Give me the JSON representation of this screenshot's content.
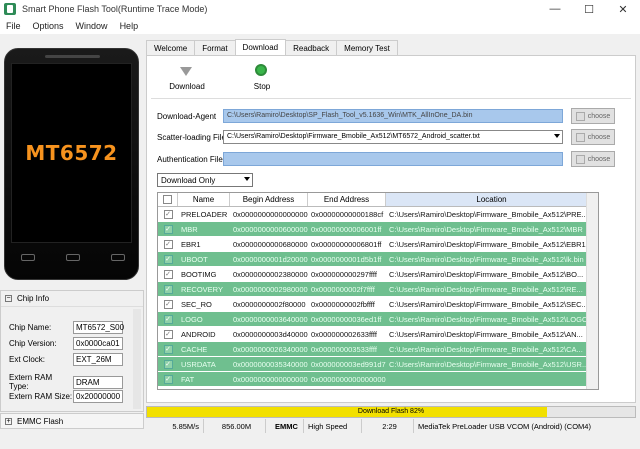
{
  "window": {
    "title": "Smart Phone Flash Tool(Runtime Trace Mode)",
    "minimize": "—",
    "maximize": "☐",
    "close": "✕"
  },
  "menu": [
    "File",
    "Options",
    "Window",
    "Help"
  ],
  "phone": {
    "chip": "MT6572"
  },
  "chip_info": {
    "title": "Chip Info",
    "expand": "−",
    "rows": [
      {
        "label": "Chip Name:",
        "value": "MT6572_S00"
      },
      {
        "label": "Chip Version:",
        "value": "0x0000ca01"
      },
      {
        "label": "Ext Clock:",
        "value": "EXT_26M"
      },
      {
        "label": "Extern RAM Type:",
        "value": "DRAM"
      },
      {
        "label": "Extern RAM Size:",
        "value": "0x20000000"
      }
    ]
  },
  "emmc": {
    "label": "EMMC Flash",
    "expand": "+"
  },
  "tabs": [
    "Welcome",
    "Format",
    "Download",
    "Readback",
    "Memory Test"
  ],
  "toolbar": {
    "download": "Download",
    "stop": "Stop"
  },
  "form": {
    "download_agent_label": "Download-Agent",
    "download_agent_value": "C:\\Users\\Ramiro\\Desktop\\SP_Flash_Tool_v5.1636_Win\\MTK_AllInOne_DA.bin",
    "scatter_label": "Scatter-loading File",
    "scatter_value": "C:\\Users\\Ramiro\\Desktop\\Firmware_Bmobile_Ax512\\MT6572_Android_scatter.txt",
    "auth_label": "Authentication File",
    "auth_value": "",
    "choose": "choose",
    "mode": "Download Only"
  },
  "table": {
    "headers": [
      "",
      "Name",
      "Begin Address",
      "End Address",
      "Location"
    ],
    "rows": [
      {
        "name": "PRELOADER",
        "begin": "0x0000000000000000",
        "end": "0x00000000000188cf",
        "loc": "C:\\Users\\Ramiro\\Desktop\\Firmware_Bmobile_Ax512\\PRE...",
        "style": "white"
      },
      {
        "name": "MBR",
        "begin": "0x0000000000600000",
        "end": "0x00000000006001ff",
        "loc": "C:\\Users\\Ramiro\\Desktop\\Firmware_Bmobile_Ax512\\MBR",
        "style": "green"
      },
      {
        "name": "EBR1",
        "begin": "0x0000000000680000",
        "end": "0x00000000006801ff",
        "loc": "C:\\Users\\Ramiro\\Desktop\\Firmware_Bmobile_Ax512\\EBR1",
        "style": "white"
      },
      {
        "name": "UBOOT",
        "begin": "0x0000000001d20000",
        "end": "0x0000000001d5b1ff",
        "loc": "C:\\Users\\Ramiro\\Desktop\\Firmware_Bmobile_Ax512\\lk.bin",
        "style": "green"
      },
      {
        "name": "BOOTIMG",
        "begin": "0x0000000002380000",
        "end": "0x000000000297ffff",
        "loc": "C:\\Users\\Ramiro\\Desktop\\Firmware_Bmobile_Ax512\\BO...",
        "style": "white"
      },
      {
        "name": "RECOVERY",
        "begin": "0x0000000002980000",
        "end": "0x0000000002f7ffff",
        "loc": "C:\\Users\\Ramiro\\Desktop\\Firmware_Bmobile_Ax512\\RE...",
        "style": "green"
      },
      {
        "name": "SEC_RO",
        "begin": "0x0000000002f80000",
        "end": "0x0000000002fbffff",
        "loc": "C:\\Users\\Ramiro\\Desktop\\Firmware_Bmobile_Ax512\\SEC...",
        "style": "white"
      },
      {
        "name": "LOGO",
        "begin": "0x0000000003640000",
        "end": "0x00000000036ed1ff",
        "loc": "C:\\Users\\Ramiro\\Desktop\\Firmware_Bmobile_Ax512\\LOGO",
        "style": "green"
      },
      {
        "name": "ANDROID",
        "begin": "0x0000000003d40000",
        "end": "0x000000002633ffff",
        "loc": "C:\\Users\\Ramiro\\Desktop\\Firmware_Bmobile_Ax512\\AN...",
        "style": "white"
      },
      {
        "name": "CACHE",
        "begin": "0x0000000026340000",
        "end": "0x000000003533ffff",
        "loc": "C:\\Users\\Ramiro\\Desktop\\Firmware_Bmobile_Ax512\\CA...",
        "style": "green"
      },
      {
        "name": "USRDATA",
        "begin": "0x0000000035340000",
        "end": "0x000000003ed991d7",
        "loc": "C:\\Users\\Ramiro\\Desktop\\Firmware_Bmobile_Ax512\\USR...",
        "style": "green"
      },
      {
        "name": "FAT",
        "begin": "0x0000000000000000",
        "end": "0x0000000000000000",
        "loc": "",
        "style": "green"
      }
    ]
  },
  "progress": {
    "label": "Download Flash 82%",
    "value": 0.82,
    "color": "#f2e000"
  },
  "status": {
    "speed": "5.85M/s",
    "size": "856.00M",
    "storage": "EMMC",
    "mode": "High Speed",
    "time": "2:29",
    "port": "MediaTek PreLoader USB VCOM (Android) (COM4)"
  }
}
